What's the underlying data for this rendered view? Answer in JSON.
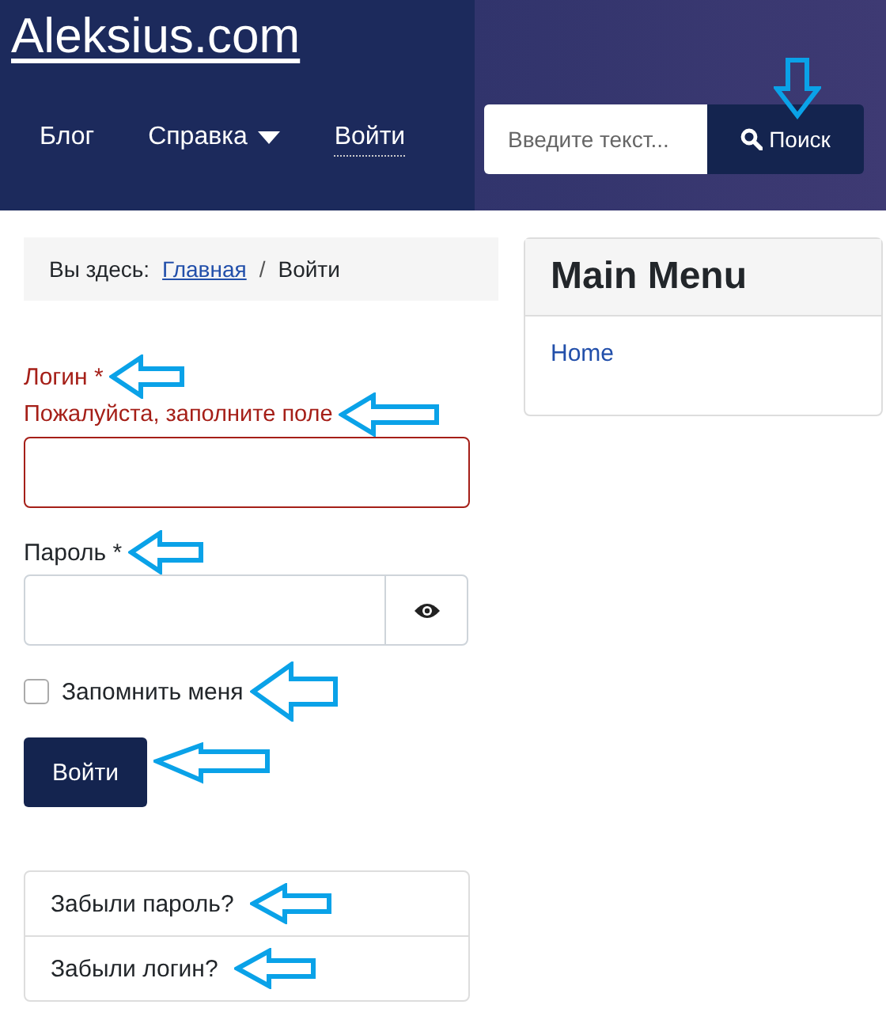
{
  "site_title": "Aleksius.com",
  "nav": [
    {
      "label": "Блог",
      "selected": false,
      "dropdown": false
    },
    {
      "label": "Справка",
      "selected": false,
      "dropdown": true
    },
    {
      "label": "Войти",
      "selected": true,
      "dropdown": false
    }
  ],
  "search": {
    "placeholder": "Введите текст...",
    "button": "Поиск"
  },
  "breadcrumb": {
    "prefix": "Вы здесь:",
    "separator": "/",
    "items": [
      {
        "label": "Главная",
        "link": true
      },
      {
        "label": "Войти",
        "link": false
      }
    ]
  },
  "fields": [
    {
      "label": "Логин *",
      "error": "Пожалуйста, заполните поле",
      "invalid": true,
      "kind": "text"
    },
    {
      "label": "Пароль *",
      "invalid": false,
      "kind": "password"
    }
  ],
  "remember": {
    "label": "Запомнить меня",
    "checked": false
  },
  "submit": "Войти",
  "links": [
    "Забыли пароль?",
    "Забыли логин?"
  ],
  "sidebar": {
    "title": "Main Menu",
    "items": [
      "Home"
    ]
  }
}
